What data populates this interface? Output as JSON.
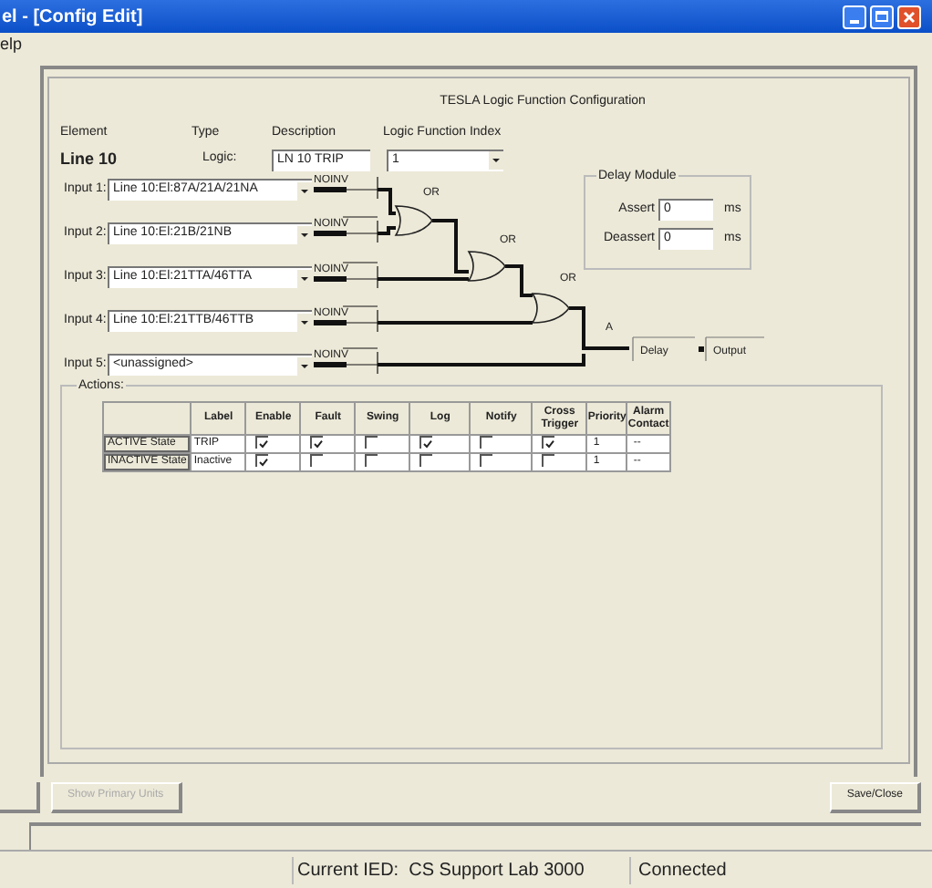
{
  "window": {
    "title": "el - [Config Edit]"
  },
  "menu": [
    "elp"
  ],
  "heading": "TESLA Logic Function Configuration",
  "columns": [
    "Element",
    "Type",
    "Description",
    "Logic Function Index"
  ],
  "element": {
    "name": "Line 10",
    "type": "Logic:",
    "description": "LN 10 TRIP",
    "index": "1"
  },
  "inputs": [
    {
      "label": "Input 1:",
      "value": "Line 10:El:87A/21A/21NA",
      "gate_label": "NOINV"
    },
    {
      "label": "Input 2:",
      "value": "Line 10:El:21B/21NB",
      "gate_label": "NOINV"
    },
    {
      "label": "Input 3:",
      "value": "Line 10:El:21TTA/46TTA",
      "gate_label": "NOINV"
    },
    {
      "label": "Input 4:",
      "value": "Line 10:El:21TTB/46TTB",
      "gate_label": "NOINV"
    },
    {
      "label": "Input 5:",
      "value": "<unassigned>",
      "gate_label": "NOINV"
    }
  ],
  "gates": [
    "OR",
    "OR",
    "OR",
    "A"
  ],
  "delay_module": {
    "title": "Delay Module",
    "fields": [
      {
        "label": "Assert",
        "value": "0",
        "unit": "ms"
      },
      {
        "label": "Deassert",
        "value": "0",
        "unit": "ms"
      }
    ]
  },
  "blocks": [
    "Delay",
    "Output"
  ],
  "actions": {
    "title": "Actions:",
    "columns": [
      "Label",
      "Enable",
      "Fault",
      "Swing",
      "Log",
      "Notify",
      "Cross Trigger",
      "Priority",
      "Alarm Contact"
    ],
    "rows": [
      {
        "state": "ACTIVE State",
        "label": "TRIP",
        "checks": [
          true,
          true,
          false,
          true,
          false,
          true
        ],
        "priority": "1",
        "alarm_contact": "--"
      },
      {
        "state": "INACTIVE State",
        "label": "Inactive",
        "checks": [
          true,
          false,
          false,
          false,
          false,
          false
        ],
        "priority": "1",
        "alarm_contact": "--"
      }
    ]
  },
  "buttons": [
    {
      "label": "Show Primary Units",
      "disabled": true
    },
    {
      "label": "Save/Close",
      "disabled": false
    }
  ],
  "status_bar": [
    "Current IED:  CS Support Lab 3000",
    "Connected"
  ]
}
